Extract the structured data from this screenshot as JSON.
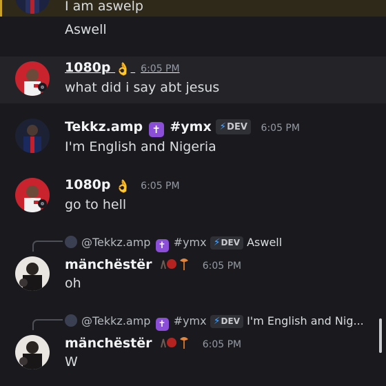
{
  "messages": [
    {
      "text": "I am aswelp"
    },
    {
      "text": "Aswell"
    },
    {
      "author": "1080p",
      "emoji": "👌",
      "time": "6:05 PM",
      "text": "what did i say abt jesus"
    },
    {
      "author": "Tekkz.amp",
      "cross": "✝",
      "tag": "#ymx",
      "badge": "DEV",
      "time": "6:05 PM",
      "text": "I'm English and Nigeria"
    },
    {
      "author": "1080p",
      "emoji": "👌",
      "time": "6:05 PM",
      "text": "go to hell"
    },
    {
      "reply_to": "@Tekkz.amp",
      "reply_cross": "✝",
      "reply_tag": "#ymx",
      "reply_badge": "DEV",
      "reply_text": "Aswell",
      "author": "mänchëstër",
      "time": "6:05 PM",
      "text": "oh"
    },
    {
      "reply_to": "@Tekkz.amp",
      "reply_cross": "✝",
      "reply_tag": "#ymx",
      "reply_badge": "DEV",
      "reply_text": "I'm English and Nig...",
      "author": "mänchëstër",
      "time": "6:05 PM",
      "text": "W"
    }
  ],
  "icons": {
    "ok_hand": "ok-hand-emoji",
    "cross": "latin-cross-icon",
    "bolt": "lightning-bolt-icon",
    "status": "offline-status-icon"
  },
  "colors": {
    "background": "#1a1a1e",
    "hover_row": "#232328",
    "mention_bar": "#c9a227",
    "cross_badge": "#8a4fd6",
    "bolt": "#4aa3ff"
  }
}
